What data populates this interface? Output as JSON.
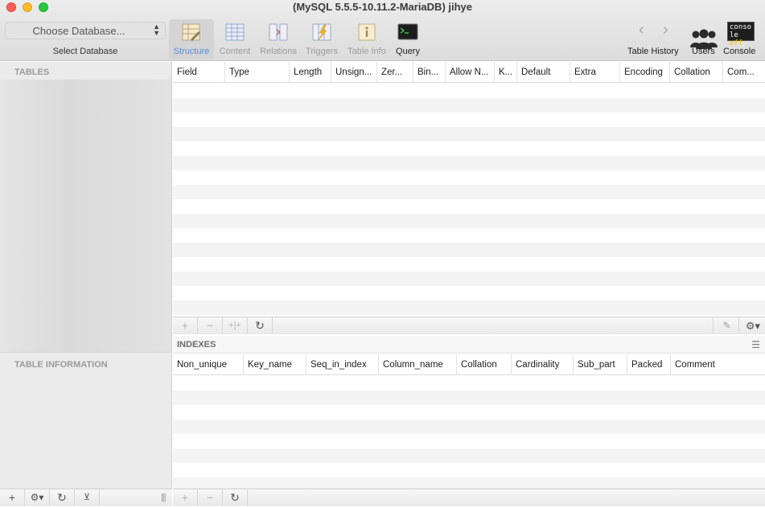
{
  "window": {
    "title": "(MySQL 5.5.5-10.11.2-MariaDB) jihye"
  },
  "toolbar": {
    "database_select": {
      "value": "Choose Database...",
      "caption": "Select Database"
    },
    "tools": [
      {
        "label": "Structure",
        "icon": "structure-icon",
        "state": "active"
      },
      {
        "label": "Content",
        "icon": "content-icon",
        "state": "disabled"
      },
      {
        "label": "Relations",
        "icon": "relations-icon",
        "state": "disabled"
      },
      {
        "label": "Triggers",
        "icon": "triggers-icon",
        "state": "disabled"
      },
      {
        "label": "Table Info",
        "icon": "table-info-icon",
        "state": "disabled"
      },
      {
        "label": "Query",
        "icon": "terminal-icon",
        "state": "enabled"
      }
    ],
    "history_label": "Table History",
    "users_label": "Users",
    "console_label": "Console",
    "console_icon_text": {
      "line1": "conso",
      "line2a": "le ",
      "line2b": "off"
    }
  },
  "sidebar": {
    "tables_header": "TABLES",
    "table_info_header": "TABLE INFORMATION"
  },
  "fields_grid": {
    "columns": [
      "Field",
      "Type",
      "Length",
      "Unsign...",
      "Zer...",
      "Bin...",
      "Allow N...",
      "K...",
      "Default",
      "Extra",
      "Encoding",
      "Collation",
      "Com..."
    ]
  },
  "indexes": {
    "title": "INDEXES",
    "columns": [
      "Non_unique",
      "Key_name",
      "Seq_in_index",
      "Column_name",
      "Collation",
      "Cardinality",
      "Sub_part",
      "Packed",
      "Comment"
    ]
  },
  "colors": {
    "accent": "#5b8ed6",
    "header_text": "#9a9a9a"
  }
}
